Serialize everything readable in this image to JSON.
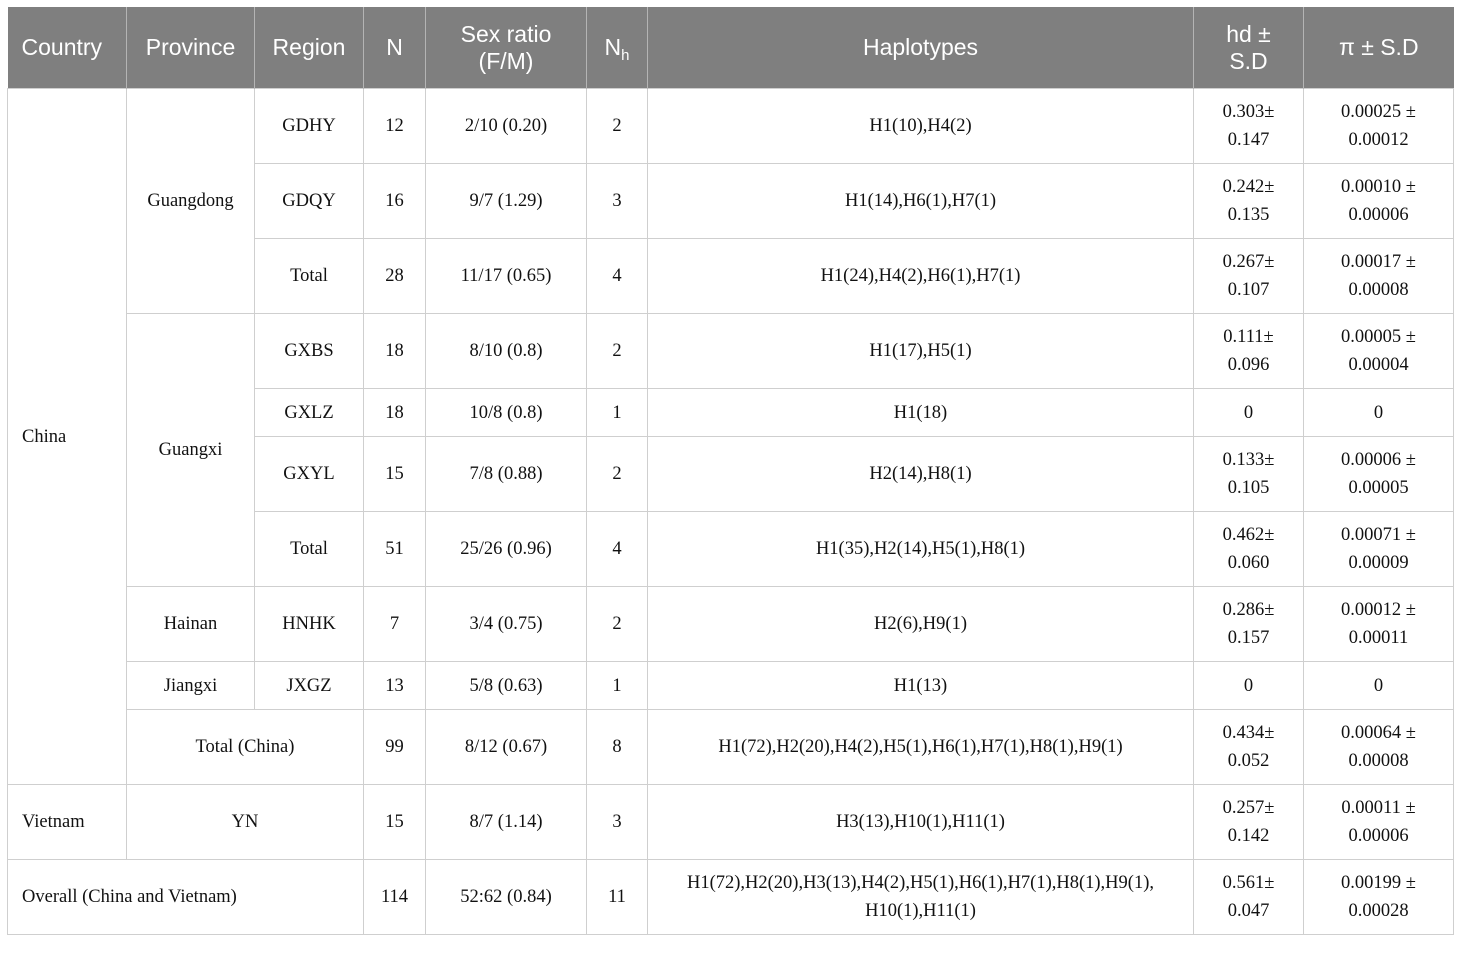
{
  "headers": {
    "country": "Country",
    "province": "Province",
    "region": "Region",
    "n": "N",
    "sex_ratio": "Sex ratio (F/M)",
    "nh_main": "N",
    "nh_sub": "h",
    "haplotypes": "Haplotypes",
    "hd": "hd ± S.D",
    "pi": "π ± S.D"
  },
  "rows": [
    {
      "country": "China",
      "province": "Guangdong",
      "region": "GDHY",
      "n": "12",
      "sex_ratio": "2/10 (0.20)",
      "nh": "2",
      "haplotypes": "H1(10),H4(2)",
      "hd1": "0.303±",
      "hd2": "0.147",
      "pi1": "0.00025 ±",
      "pi2": "0.00012"
    },
    {
      "region": "GDQY",
      "n": "16",
      "sex_ratio": "9/7 (1.29)",
      "nh": "3",
      "haplotypes": "H1(14),H6(1),H7(1)",
      "hd1": "0.242±",
      "hd2": "0.135",
      "pi1": "0.00010 ±",
      "pi2": "0.00006"
    },
    {
      "region": "Total",
      "n": "28",
      "sex_ratio": "11/17 (0.65)",
      "nh": "4",
      "haplotypes": "H1(24),H4(2),H6(1),H7(1)",
      "hd1": "0.267±",
      "hd2": "0.107",
      "pi1": "0.00017 ±",
      "pi2": "0.00008"
    },
    {
      "province": "Guangxi",
      "region": "GXBS",
      "n": "18",
      "sex_ratio": "8/10 (0.8)",
      "nh": "2",
      "haplotypes": "H1(17),H5(1)",
      "hd1": "0.111±",
      "hd2": "0.096",
      "pi1": "0.00005 ±",
      "pi2": "0.00004"
    },
    {
      "region": "GXLZ",
      "n": "18",
      "sex_ratio": "10/8 (0.8)",
      "nh": "1",
      "haplotypes": "H1(18)",
      "hd1": "0",
      "hd2": "",
      "pi1": "0",
      "pi2": ""
    },
    {
      "region": "GXYL",
      "n": "15",
      "sex_ratio": "7/8 (0.88)",
      "nh": "2",
      "haplotypes": "H2(14),H8(1)",
      "hd1": "0.133±",
      "hd2": "0.105",
      "pi1": "0.00006 ±",
      "pi2": "0.00005"
    },
    {
      "region": "Total",
      "n": "51",
      "sex_ratio": "25/26 (0.96)",
      "nh": "4",
      "haplotypes": "H1(35),H2(14),H5(1),H8(1)",
      "hd1": "0.462±",
      "hd2": "0.060",
      "pi1": "0.00071 ±",
      "pi2": "0.00009"
    },
    {
      "province": "Hainan",
      "region": "HNHK",
      "n": "7",
      "sex_ratio": "3/4 (0.75)",
      "nh": "2",
      "haplotypes": "H2(6),H9(1)",
      "hd1": "0.286±",
      "hd2": "0.157",
      "pi1": "0.00012 ±",
      "pi2": "0.00011"
    },
    {
      "province": "Jiangxi",
      "region": "JXGZ",
      "n": "13",
      "sex_ratio": "5/8 (0.63)",
      "nh": "1",
      "haplotypes": "H1(13)",
      "hd1": "0",
      "hd2": "",
      "pi1": "0",
      "pi2": ""
    },
    {
      "total_label": "Total (China)",
      "n": "99",
      "sex_ratio": "8/12 (0.67)",
      "nh": "8",
      "haplotypes": "H1(72),H2(20),H4(2),H5(1),H6(1),H7(1),H8(1),H9(1)",
      "hd1": "0.434±",
      "hd2": "0.052",
      "pi1": "0.00064 ±",
      "pi2": "0.00008"
    },
    {
      "country": "Vietnam",
      "province_region": "YN",
      "n": "15",
      "sex_ratio": "8/7 (1.14)",
      "nh": "3",
      "haplotypes": "H3(13),H10(1),H11(1)",
      "hd1": "0.257±",
      "hd2": "0.142",
      "pi1": "0.00011 ±",
      "pi2": "0.00006"
    },
    {
      "overall_label": "Overall (China and Vietnam)",
      "n": "114",
      "sex_ratio": "52:62 (0.84)",
      "nh": "11",
      "haplotypes1": "H1(72),H2(20),H3(13),H4(2),H5(1),H6(1),H7(1),H8(1),H9(1),",
      "haplotypes2": "H10(1),H11(1)",
      "hd1": "0.561±",
      "hd2": "0.047",
      "pi1": "0.00199 ±",
      "pi2": "0.00028"
    }
  ]
}
